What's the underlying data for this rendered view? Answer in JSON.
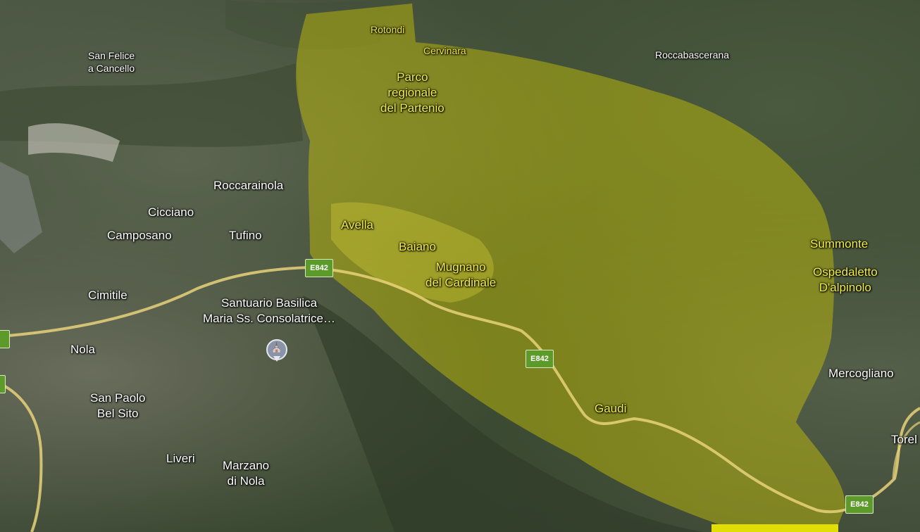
{
  "map": {
    "highlight_color": "#d6d000",
    "road_color": "#e8d27a",
    "places": {
      "rotondi": "Rotondi",
      "cervinara": "Cervinara",
      "roccabascerana": "Roccabascerana",
      "san_felice": [
        "San Felice",
        "a Cancello"
      ],
      "parco": [
        "Parco",
        "regionale",
        "del Partenio"
      ],
      "roccarainola": "Roccarainola",
      "cicciano": "Cicciano",
      "camposano": "Camposano",
      "tufino": "Tufino",
      "avella": "Avella",
      "baiano": "Baiano",
      "mugnano": [
        "Mugnano",
        "del Cardinale"
      ],
      "summonte": "Summonte",
      "ospedaletto": [
        "Ospedaletto",
        "D'alpinolo"
      ],
      "cimitile": "Cimitile",
      "santuario": [
        "Santuario Basilica",
        "Maria Ss. Consolatrice…"
      ],
      "nola": "Nola",
      "san_paolo": [
        "San Paolo",
        "Bel Sito"
      ],
      "mercogliano": "Mercogliano",
      "gaudi": "Gaudi",
      "liveri": "Liveri",
      "marzano": [
        "Marzano",
        "di Nola"
      ],
      "torelli": "Torel"
    },
    "road_shields": [
      "E842",
      "E842",
      "E842",
      "2",
      "2"
    ],
    "poi_icon": "church-icon"
  }
}
